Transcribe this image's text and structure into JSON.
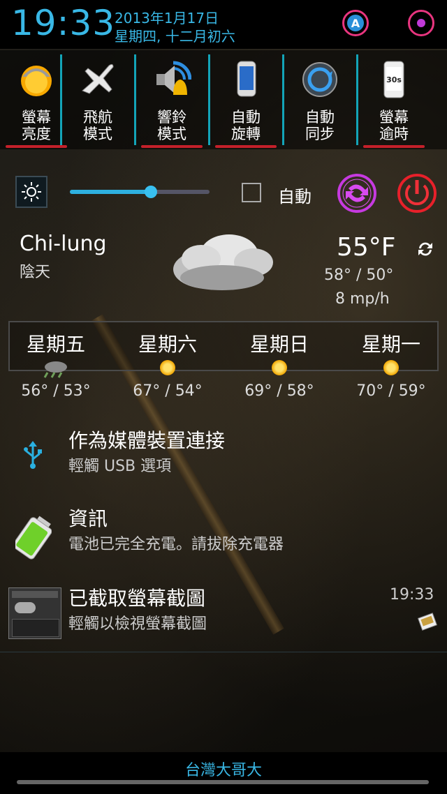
{
  "status": {
    "time": "19:33",
    "date_line1": "2013年1月17日",
    "date_line2": "星期四, 十二月初六",
    "ring_a_letter": "A"
  },
  "toggles": [
    {
      "line1": "螢幕",
      "line2": "亮度",
      "icon": "sun-brightness-icon"
    },
    {
      "line1": "飛航",
      "line2": "模式",
      "icon": "airplane-icon"
    },
    {
      "line1": "響鈴",
      "line2": "模式",
      "icon": "speaker-bell-icon"
    },
    {
      "line1": "自動",
      "line2": "旋轉",
      "icon": "phone-rotate-icon"
    },
    {
      "line1": "自動",
      "line2": "同步",
      "icon": "sync-icon"
    },
    {
      "line1": "螢幕",
      "line2": "逾時",
      "icon": "screen-timeout-icon",
      "badge": "30s"
    }
  ],
  "brightness": {
    "level": 0.58,
    "auto_label": "自動",
    "auto_checked": false
  },
  "weather": {
    "city": "Chi-lung",
    "condition": "陰天",
    "temperature": "55°F",
    "hi_lo": "58° / 50°",
    "wind": "8 mp/h",
    "forecast": [
      {
        "day": "星期五",
        "temps": "56° / 53°",
        "icon": "rain-icon"
      },
      {
        "day": "星期六",
        "temps": "67° / 54°",
        "icon": "sun-icon"
      },
      {
        "day": "星期日",
        "temps": "69° / 58°",
        "icon": "sun-icon"
      },
      {
        "day": "星期一",
        "temps": "70° / 59°",
        "icon": "sun-icon"
      }
    ]
  },
  "notifications": [
    {
      "title": "作為媒體裝置連接",
      "subtitle": "輕觸 USB 選項",
      "icon": "usb-icon"
    },
    {
      "title": "資訊",
      "subtitle": "電池已完全充電。請拔除充電器",
      "icon": "battery-full-icon"
    },
    {
      "title": "已截取螢幕截圖",
      "subtitle": "輕觸以檢視螢幕截圖",
      "time": "19:33",
      "icon": "screenshot-thumbnail"
    }
  ],
  "carrier": "台灣大哥大",
  "colors": {
    "accent": "#39b8e6",
    "toggle_indicator": "#c4202a",
    "separator": "#13a4b8",
    "ring": "#e8357f"
  }
}
